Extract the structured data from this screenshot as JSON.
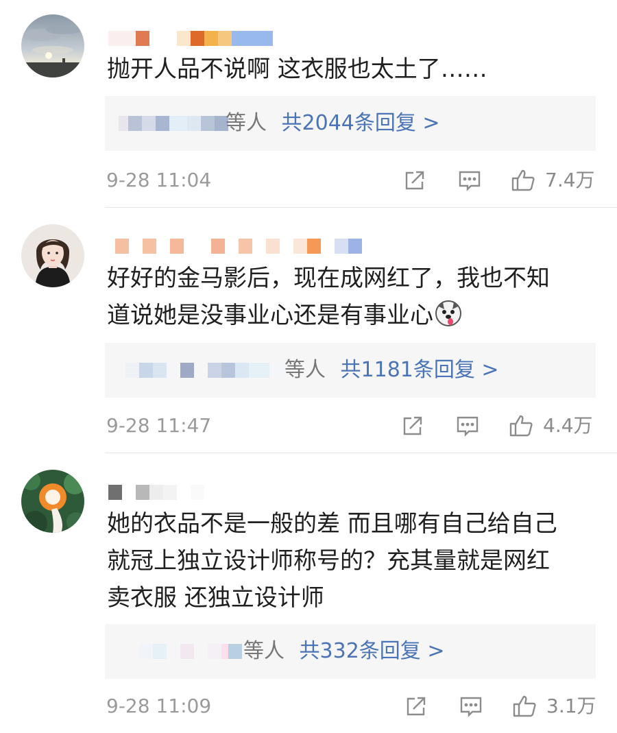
{
  "comments": [
    {
      "text_lines": [
        "抛开人品不说啊 这衣服也太土了……"
      ],
      "replies": {
        "who": "等人",
        "count": "共2044条回复 >"
      },
      "time": "9-28 11:04",
      "likes": "7.4万"
    },
    {
      "text_lines": [
        "好好的金马影后，现在成网红了，我也不知",
        "道说她是没事业心还是有事业心"
      ],
      "replies": {
        "who": "等人",
        "count": "共1181条回复 >"
      },
      "time": "9-28 11:47",
      "likes": "4.4万"
    },
    {
      "text_lines": [
        "她的衣品不是一般的差 而且哪有自己给自己",
        "就冠上独立设计师称号的？充其量就是网红",
        "卖衣服 还独立设计师"
      ],
      "replies": {
        "who": "等人",
        "count": "共332条回复 >"
      },
      "time": "9-28 11:09",
      "likes": "3.1万"
    }
  ],
  "icons": {
    "share": "share-icon",
    "comment": "comment-icon",
    "like": "thumbs-up-icon",
    "emoji": "dog-emoji-icon"
  },
  "colors": {
    "reply_link": "#4a74b5",
    "meta_text": "#9a9a9a",
    "reply_bg": "#f6f6f6"
  }
}
